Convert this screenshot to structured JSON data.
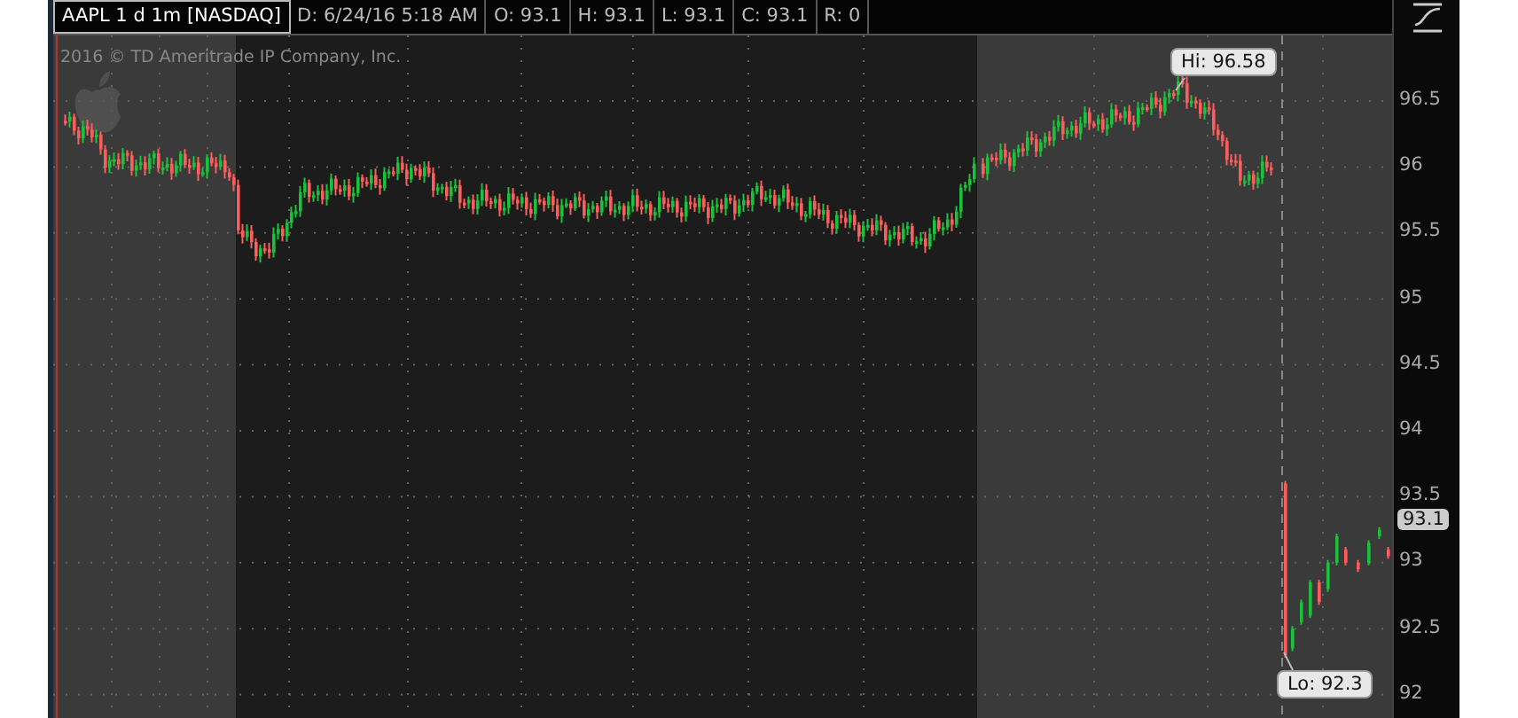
{
  "header": {
    "symbol": "AAPL 1 d 1m [NASDAQ]",
    "fields": [
      "D: 6/24/16 5:18 AM",
      "O: 93.1",
      "H: 93.1",
      "L: 93.1",
      "C: 93.1",
      "R: 0"
    ]
  },
  "copyright": "2016 © TD Ameritrade IP Company, Inc.",
  "y_axis": [
    "96.5",
    "96",
    "95.5",
    "95",
    "94.5",
    "94",
    "93.5",
    "93",
    "92.5",
    "92"
  ],
  "high_label": "Hi: 96.58",
  "low_label": "Lo: 92.3",
  "last_price": "93.1"
}
